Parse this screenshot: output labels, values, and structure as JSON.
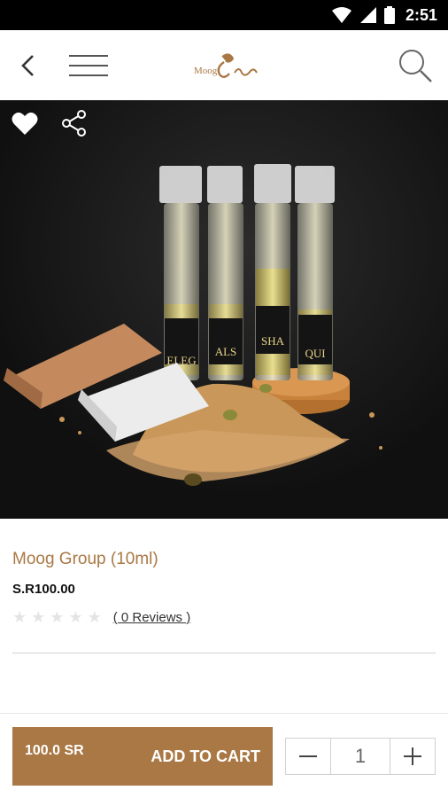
{
  "status_bar": {
    "time": "2:51",
    "icons": [
      "wifi-icon",
      "signal-icon",
      "battery-icon"
    ]
  },
  "header": {
    "logo_text": "Moog",
    "icons": [
      "back-icon",
      "menu-icon",
      "search-icon"
    ]
  },
  "hero": {
    "actions": [
      "heart-icon",
      "share-icon"
    ],
    "bottle_labels": [
      "ELEG",
      "ALS",
      "SHA",
      "QUI"
    ]
  },
  "product": {
    "title": "Moog Group (10ml)",
    "price": "S.R100.00",
    "rating": 0,
    "rating_max": 5,
    "reviews": "( 0 Reviews )"
  },
  "cart": {
    "price": "100.0 SR",
    "label": "ADD TO CART",
    "quantity": "1"
  },
  "colors": {
    "accent": "#a97845",
    "hero_bg": "#151515",
    "status_bar": "#000000"
  }
}
